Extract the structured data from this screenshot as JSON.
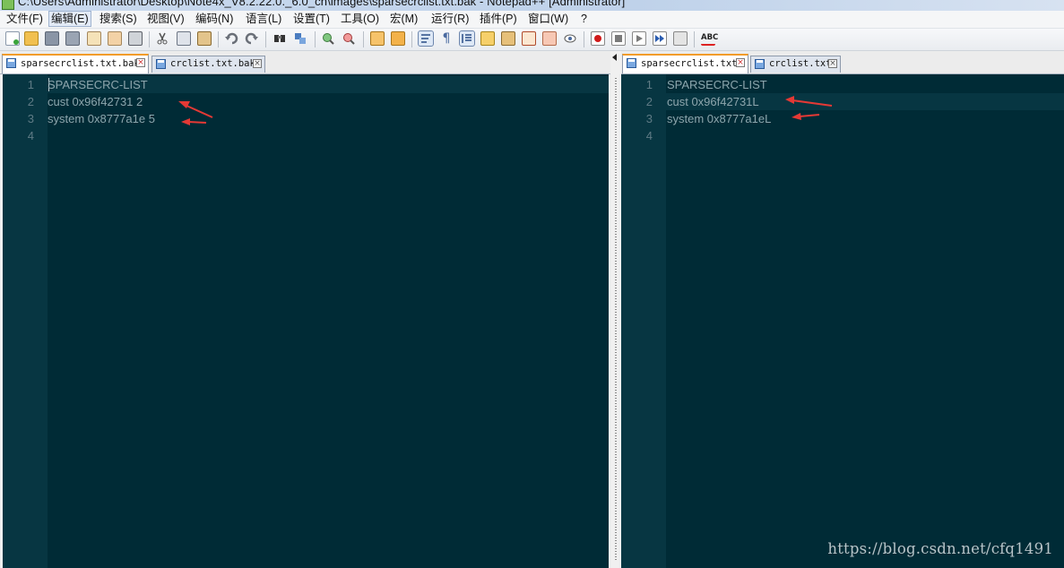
{
  "window": {
    "title": "C:\\Users\\Administrator\\Desktop\\Note4x_V8.2.22.0._6.0_cn\\images\\sparsecrclist.txt.bak - Notepad++ [Administrator]"
  },
  "menu": [
    "文件(F)",
    "编辑(E)",
    "搜索(S)",
    "视图(V)",
    "编码(N)",
    "语言(L)",
    "设置(T)",
    "工具(O)",
    "宏(M)",
    "运行(R)",
    "插件(P)",
    "窗口(W)",
    "?"
  ],
  "toolbar": {
    "icons": [
      "new-file-icon",
      "open-file-icon",
      "save-icon",
      "save-all-icon",
      "close-icon",
      "close-all-icon",
      "print-icon",
      "cut-icon",
      "copy-icon",
      "paste-icon",
      "undo-icon",
      "redo-icon",
      "find-icon",
      "replace-icon",
      "zoom-in-icon",
      "zoom-out-icon",
      "sync-vertical-icon",
      "sync-horizontal-icon",
      "word-wrap-icon",
      "show-all-chars-icon",
      "indent-guide-icon",
      "user-lang-icon",
      "doc-map-icon",
      "function-list-icon",
      "folder-workspace-icon",
      "monitor-icon",
      "record-macro-icon",
      "stop-record-icon",
      "play-macro-icon",
      "run-macro-multiple-icon",
      "save-macro-icon",
      "spell-check-icon"
    ],
    "spell_label": "ABC"
  },
  "left_pane": {
    "tabs": [
      {
        "label": "sparsecrclist.txt.bak",
        "active": true
      },
      {
        "label": "crclist.txt.bak",
        "active": false
      }
    ],
    "lines": [
      {
        "num": "1",
        "text": "SPARSECRC-LIST"
      },
      {
        "num": "2",
        "text": "cust 0x96f42731 2"
      },
      {
        "num": "3",
        "text": "system 0x8777a1e 5"
      },
      {
        "num": "4",
        "text": ""
      }
    ]
  },
  "right_pane": {
    "tabs": [
      {
        "label": "sparsecrclist.txt",
        "active": true
      },
      {
        "label": "crclist.txt",
        "active": false
      }
    ],
    "lines": [
      {
        "num": "1",
        "text": "SPARSECRC-LIST"
      },
      {
        "num": "2",
        "text": "cust 0x96f42731L"
      },
      {
        "num": "3",
        "text": "system 0x8777a1eL"
      },
      {
        "num": "4",
        "text": ""
      }
    ]
  },
  "watermark": "https://blog.csdn.net/cfq1491",
  "colors": {
    "editor_bg": "#002b36",
    "gutter_bg": "#073642",
    "text": "#8ea6ad",
    "annotation_arrow": "#e53935",
    "active_tab_accent": "#f29c2a"
  }
}
